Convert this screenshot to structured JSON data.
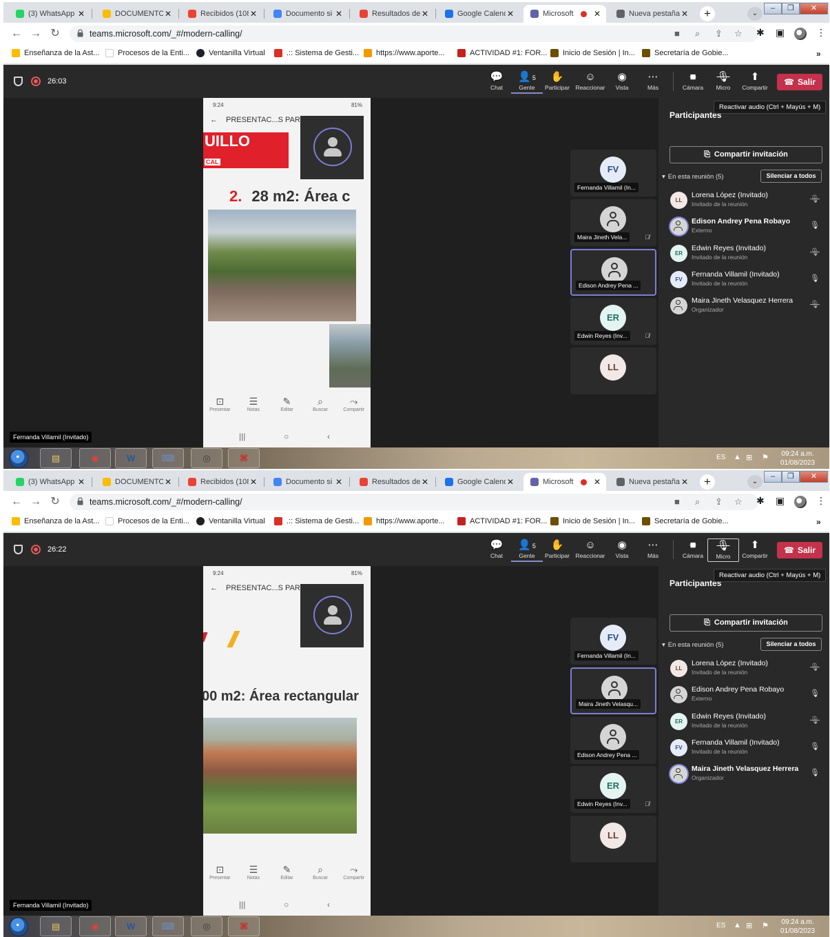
{
  "screens": [
    {
      "tabs": [
        {
          "label": "(3) WhatsApp",
          "color": "#25d366"
        },
        {
          "label": "DOCUMENTO",
          "color": "#fbbc04"
        },
        {
          "label": "Recibidos (108",
          "color": "#ea4335"
        },
        {
          "label": "Documento si",
          "color": "#4285f4"
        },
        {
          "label": "Resultados de",
          "color": "#ea4335"
        },
        {
          "label": "Google Calend",
          "color": "#1a73e8"
        },
        {
          "label": "Microsoft",
          "color": "#6264a7"
        },
        {
          "label": "Nueva pestaña",
          "color": "#5f6368"
        }
      ],
      "url": "teams.microsoft.com/_#/modern-calling/",
      "bookmarks": [
        "Enseñanza de la Ast...",
        "Procesos de la Enti...",
        "Ventanilla Virtual",
        ".:: Sistema de Gesti...",
        "https://www.aporte...",
        "ACTIVIDAD #1: FOR...",
        "Inicio de Sesión | In...",
        "Secretaría de Gobie..."
      ],
      "timer": "26:03",
      "controls": {
        "chat": "Chat",
        "people": "Gente",
        "people_count": "5",
        "raise": "Participar",
        "react": "Reaccionar",
        "view": "Vista",
        "more": "Más",
        "camera": "Cámara",
        "mic": "Micro",
        "share": "Compartir",
        "leave": "Salir"
      },
      "phone": {
        "status_left": "9:24",
        "status_right": "81%",
        "title": "PRESENTAC...S PARK",
        "banner": "UILLO",
        "banner_sub": "CAL",
        "slide_number": "2.",
        "slide_title": "28 m2:  Área c",
        "buttons": [
          "Presentar",
          "Notas",
          "Editar",
          "Buscar",
          "Compartir"
        ]
      },
      "speaker": "Fernanda Villamil (Invitado)",
      "tiles": [
        {
          "initials": "FV",
          "name": "Fernanda Villamil (In...",
          "type": "fv",
          "muted": false
        },
        {
          "initials": "",
          "name": "Maira Jineth Vela...",
          "type": "gen",
          "muted": true
        },
        {
          "initials": "",
          "name": "Edison Andrey Pena ...",
          "type": "gen",
          "muted": false
        },
        {
          "initials": "ER",
          "name": "Edwin Reyes (Inv...",
          "type": "er",
          "muted": true
        },
        {
          "initials": "LL",
          "name": "",
          "type": "ll",
          "muted": false
        }
      ],
      "active_tile": 2,
      "panel": {
        "title": "Participantes",
        "tooltip": "Reactivar audio (Ctrl + Mayús + M)",
        "share_invite": "Compartir invitación",
        "in_meeting": "En esta reunión (5)",
        "mute_all": "Silenciar a todos",
        "participants": [
          {
            "initials": "LL",
            "name": "Lorena López (Invitado)",
            "role": "Invitado de la reunión",
            "type": "ll",
            "mic": "muted",
            "speaking": false
          },
          {
            "initials": "",
            "name": "Edison Andrey Pena Robayo",
            "role": "Externo",
            "type": "gen",
            "mic": "on",
            "speaking": true
          },
          {
            "initials": "ER",
            "name": "Edwin Reyes (Invitado)",
            "role": "Invitado de la reunión",
            "type": "er",
            "mic": "muted",
            "speaking": false
          },
          {
            "initials": "FV",
            "name": "Fernanda Villamil (Invitado)",
            "role": "Invitado de la reunión",
            "type": "fv",
            "mic": "on",
            "speaking": false
          },
          {
            "initials": "",
            "name": "Maira Jineth Velasquez Herrera",
            "role": "Organizador",
            "type": "gen",
            "mic": "muted",
            "speaking": false
          }
        ]
      },
      "taskbar": {
        "lang": "ES",
        "time": "09:24 a.m.",
        "date": "01/08/2023"
      }
    },
    {
      "tabs": [
        {
          "label": "(3) WhatsApp",
          "color": "#25d366"
        },
        {
          "label": "DOCUMENTO",
          "color": "#fbbc04"
        },
        {
          "label": "Recibidos (108",
          "color": "#ea4335"
        },
        {
          "label": "Documento si",
          "color": "#4285f4"
        },
        {
          "label": "Resultados de",
          "color": "#ea4335"
        },
        {
          "label": "Google Calend",
          "color": "#1a73e8"
        },
        {
          "label": "Microsoft",
          "color": "#6264a7"
        },
        {
          "label": "Nueva pestaña",
          "color": "#5f6368"
        }
      ],
      "url": "teams.microsoft.com/_#/modern-calling/",
      "bookmarks": [
        "Enseñanza de la Ast...",
        "Procesos de la Enti...",
        "Ventanilla Virtual",
        ".:: Sistema de Gesti...",
        "https://www.aporte...",
        "ACTIVIDAD #1: FOR...",
        "Inicio de Sesión | In...",
        "Secretaría de Gobie..."
      ],
      "timer": "26:22",
      "controls": {
        "chat": "Chat",
        "people": "Gente",
        "people_count": "5",
        "raise": "Participar",
        "react": "Reaccionar",
        "view": "Vista",
        "more": "Más",
        "camera": "Cámara",
        "mic": "Micro",
        "share": "Compartir",
        "leave": "Salir"
      },
      "phone": {
        "status_left": "9:24",
        "status_right": "81%",
        "title": "PRESENTAC...S PARK",
        "banner": "",
        "banner_sub": "",
        "slide_number": "",
        "slide_title": "00 m2:  Área rectangular",
        "buttons": [
          "Presentar",
          "Notas",
          "Editar",
          "Buscar",
          "Compartir"
        ]
      },
      "speaker": "Fernanda Villamil (Invitado)",
      "tiles": [
        {
          "initials": "FV",
          "name": "Fernanda Villamil (In...",
          "type": "fv",
          "muted": false
        },
        {
          "initials": "",
          "name": "Maira Jineth Velasqu...",
          "type": "gen",
          "muted": false
        },
        {
          "initials": "",
          "name": "Edison Andrey Pena ...",
          "type": "gen",
          "muted": false
        },
        {
          "initials": "ER",
          "name": "Edwin Reyes (Inv...",
          "type": "er",
          "muted": true
        },
        {
          "initials": "LL",
          "name": "",
          "type": "ll",
          "muted": false
        }
      ],
      "active_tile": 1,
      "panel": {
        "title": "Participantes",
        "tooltip": "Reactivar audio (Ctrl + Mayús + M)",
        "share_invite": "Compartir invitación",
        "in_meeting": "En esta reunión (5)",
        "mute_all": "Silenciar a todos",
        "participants": [
          {
            "initials": "LL",
            "name": "Lorena López (Invitado)",
            "role": "Invitado de la reunión",
            "type": "ll",
            "mic": "muted",
            "speaking": false
          },
          {
            "initials": "",
            "name": "Edison Andrey Pena Robayo",
            "role": "Externo",
            "type": "gen",
            "mic": "on",
            "speaking": false
          },
          {
            "initials": "ER",
            "name": "Edwin Reyes (Invitado)",
            "role": "Invitado de la reunión",
            "type": "er",
            "mic": "muted",
            "speaking": false
          },
          {
            "initials": "FV",
            "name": "Fernanda Villamil (Invitado)",
            "role": "Invitado de la reunión",
            "type": "fv",
            "mic": "on",
            "speaking": false
          },
          {
            "initials": "",
            "name": "Maira Jineth Velasquez Herrera",
            "role": "Organizador",
            "type": "gen",
            "mic": "on",
            "speaking": true
          }
        ]
      },
      "taskbar": {
        "lang": "ES",
        "time": "09:24 a.m.",
        "date": "01/08/2023"
      }
    }
  ]
}
